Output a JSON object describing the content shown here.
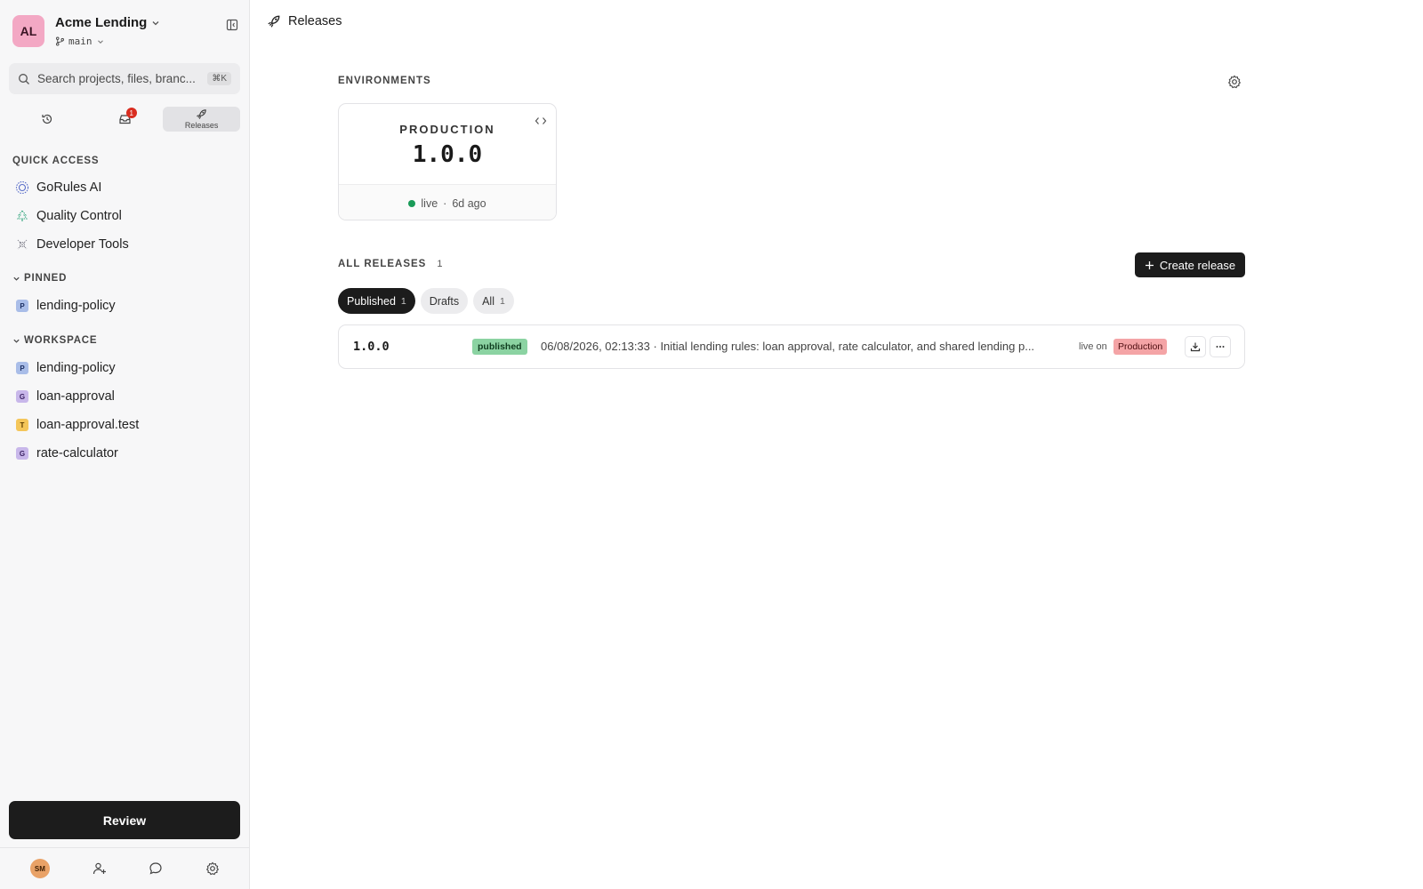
{
  "workspace": {
    "initials": "AL",
    "name": "Acme Lending",
    "branch": "main",
    "avatar_color": "#f3a8c4"
  },
  "search": {
    "placeholder": "Search projects, files, branc...",
    "shortcut": "⌘K"
  },
  "nav_tabs": [
    {
      "icon": "history-icon"
    },
    {
      "icon": "inbox-icon",
      "badge": "1"
    },
    {
      "icon": "rocket-icon",
      "label": "Releases",
      "active": true
    }
  ],
  "quick_access": {
    "heading": "QUICK ACCESS",
    "items": [
      {
        "label": "GoRules AI",
        "icon": "ai-icon"
      },
      {
        "label": "Quality Control",
        "icon": "tree-icon"
      },
      {
        "label": "Developer Tools",
        "icon": "tools-icon"
      }
    ]
  },
  "pinned": {
    "heading": "PINNED",
    "items": [
      {
        "label": "lending-policy",
        "badge": "P"
      }
    ]
  },
  "workspace_files": {
    "heading": "WORKSPACE",
    "items": [
      {
        "label": "lending-policy",
        "badge": "P"
      },
      {
        "label": "loan-approval",
        "badge": "G"
      },
      {
        "label": "loan-approval.test",
        "badge": "T"
      },
      {
        "label": "rate-calculator",
        "badge": "G"
      }
    ]
  },
  "review_button": "Review",
  "user": {
    "initials": "SM"
  },
  "page": {
    "title": "Releases"
  },
  "environments": {
    "heading": "ENVIRONMENTS",
    "cards": [
      {
        "name": "PRODUCTION",
        "version": "1.0.0",
        "status": "live",
        "age": "6d ago",
        "status_color": "#1a9b58"
      }
    ]
  },
  "releases": {
    "heading": "ALL RELEASES",
    "count": "1",
    "create_label": "Create release",
    "filters": [
      {
        "label": "Published",
        "count": "1",
        "active": true
      },
      {
        "label": "Drafts",
        "count": ""
      },
      {
        "label": "All",
        "count": "1"
      }
    ],
    "rows": [
      {
        "version": "1.0.0",
        "status": "published",
        "description": "06/08/2026, 02:13:33 · Initial lending rules: loan approval, rate calculator, and shared lending p...",
        "live_on_label": "live on",
        "environment": "Production"
      }
    ]
  },
  "colors": {
    "primary_dark": "#1c1c1c",
    "published_badge": "#8bd3a2",
    "production_badge": "#f4a4a6"
  }
}
